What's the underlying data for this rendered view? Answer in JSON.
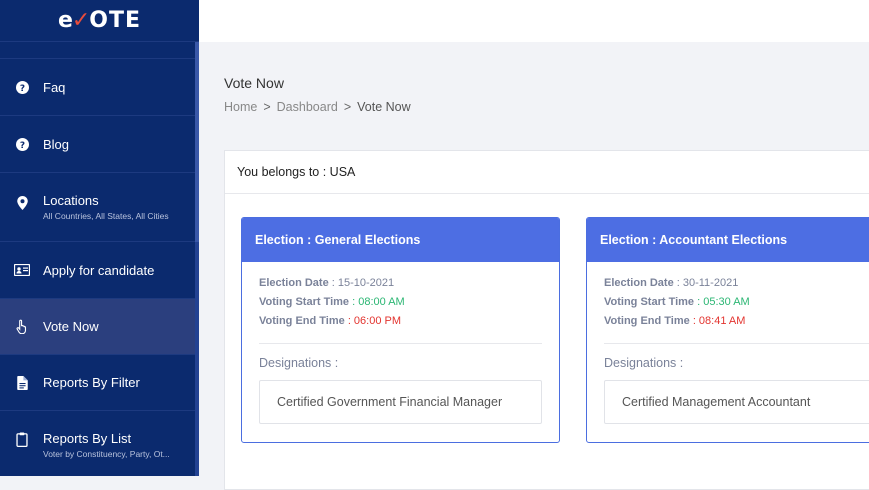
{
  "brand": {
    "logo_left": "e",
    "logo_tick": "✓",
    "logo_right": "OTE",
    "tick_color": "#e74c3c"
  },
  "sidebar": {
    "items": [
      {
        "label": "Faq",
        "icon": "question-circle-icon",
        "sub": ""
      },
      {
        "label": "Blog",
        "icon": "question-circle-icon",
        "sub": ""
      },
      {
        "label": "Locations",
        "icon": "map-pin-icon",
        "sub": "All Countries, All States, All Cities"
      },
      {
        "label": "Apply for candidate",
        "icon": "id-card-icon",
        "sub": ""
      },
      {
        "label": "Vote Now",
        "icon": "hand-pointer-icon",
        "sub": "",
        "active": true
      },
      {
        "label": "Reports By Filter",
        "icon": "document-icon",
        "sub": ""
      },
      {
        "label": "Reports By List",
        "icon": "clipboard-icon",
        "sub": "Voter by Constituency, Party, Ot..."
      }
    ]
  },
  "page": {
    "title": "Vote Now",
    "breadcrumb": {
      "home": "Home",
      "dashboard": "Dashboard",
      "current": "Vote Now",
      "separator": ">"
    }
  },
  "panel": {
    "belongs_to": "You belongs to : USA"
  },
  "elections": [
    {
      "title": "Election : General Elections",
      "date_label": "Election Date",
      "date": " : 15-10-2021",
      "start_label": "Voting Start Time",
      "start": " : 08:00 AM",
      "end_label": "Voting End Time",
      "end": " : 06:00 PM",
      "designations_label": "Designations :",
      "designation": "Certified Government Financial Manager"
    },
    {
      "title": "Election : Accountant Elections",
      "date_label": "Election Date",
      "date": " : 30-11-2021",
      "start_label": "Voting Start Time",
      "start": " : 05:30 AM",
      "end_label": "Voting End Time",
      "end": " : 08:41 AM",
      "designations_label": "Designations :",
      "designation": "Certified Management Accountant"
    }
  ],
  "colors": {
    "sidebar_bg": "#0b2a6e",
    "accent": "#4d6ee3",
    "start_time": "#2bb673",
    "end_time": "#e3342f"
  }
}
